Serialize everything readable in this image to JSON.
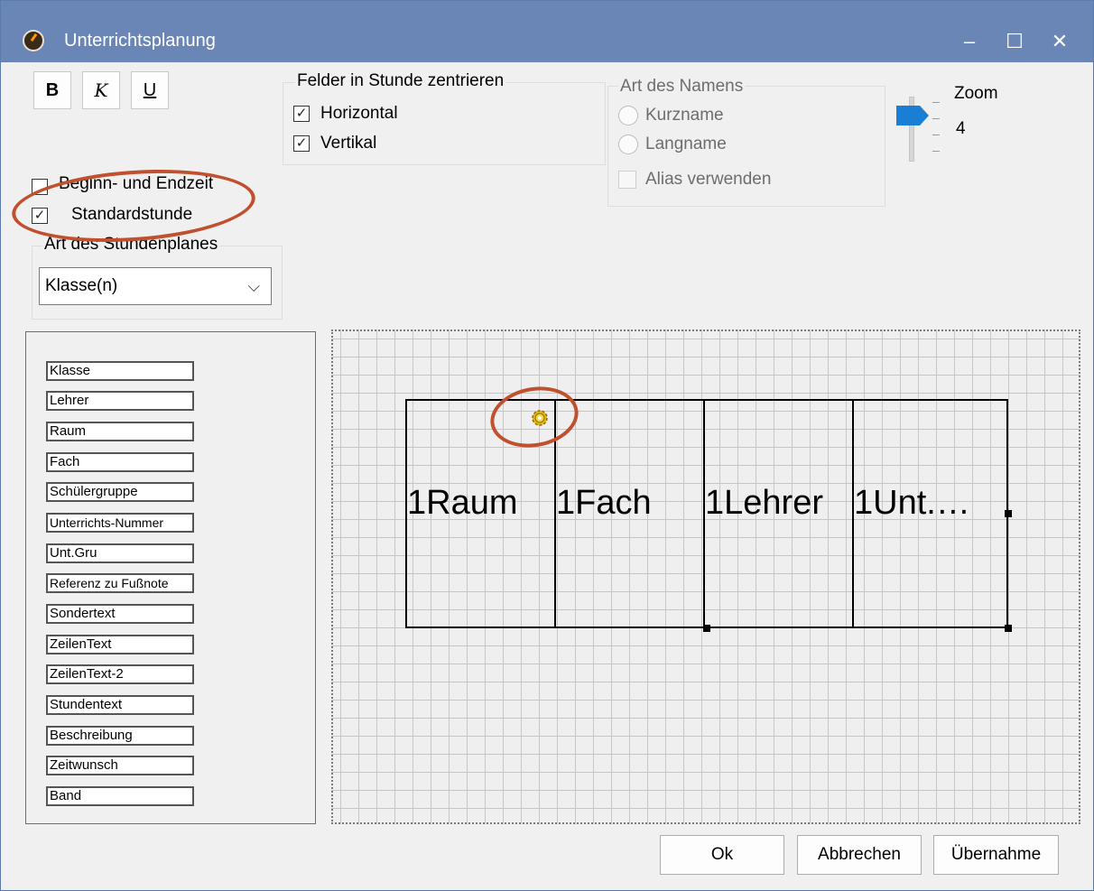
{
  "window": {
    "title": "Unterrichtsplanung",
    "controls": {
      "minimize": "–",
      "maximize": "☐",
      "close": "✕"
    }
  },
  "format_buttons": {
    "bold": "B",
    "italic": "K",
    "underline": "U"
  },
  "options": {
    "beginn_endzeit": {
      "label": "Beginn- und Endzeit",
      "checked": false
    },
    "standardstunde": {
      "label": "Standardstunde",
      "checked": true
    }
  },
  "center_group": {
    "title": "Felder in Stunde zentrieren",
    "horizontal": {
      "label": "Horizontal",
      "checked": true
    },
    "vertikal": {
      "label": "Vertikal",
      "checked": true
    }
  },
  "name_group": {
    "title": "Art des Namens",
    "kurzname": "Kurzname",
    "langname": "Langname",
    "alias": "Alias verwenden"
  },
  "zoom": {
    "label": "Zoom",
    "value": "4"
  },
  "plan_type": {
    "title": "Art des Stundenplanes",
    "selected": "Klasse(n)"
  },
  "fields": [
    "Klasse",
    "Lehrer",
    "Raum",
    "Fach",
    "Schülergruppe",
    "Unterrichts-Nummer",
    "Unt.Gru",
    "Referenz zu Fußnote",
    "Sondertext",
    "ZeilenText",
    "ZeilenText-2",
    "Stundentext",
    "Beschreibung",
    "Zeitwunsch",
    "Band"
  ],
  "layout_cells": [
    "1Raum",
    "1Fach",
    "1Lehrer",
    "1Unt.…"
  ],
  "buttons": {
    "ok": "Ok",
    "cancel": "Abbrechen",
    "apply": "Übernahme"
  },
  "colors": {
    "titlebar": "#6a86b6",
    "annotation": "#c0502e",
    "slider_thumb": "#1a7fd4"
  }
}
